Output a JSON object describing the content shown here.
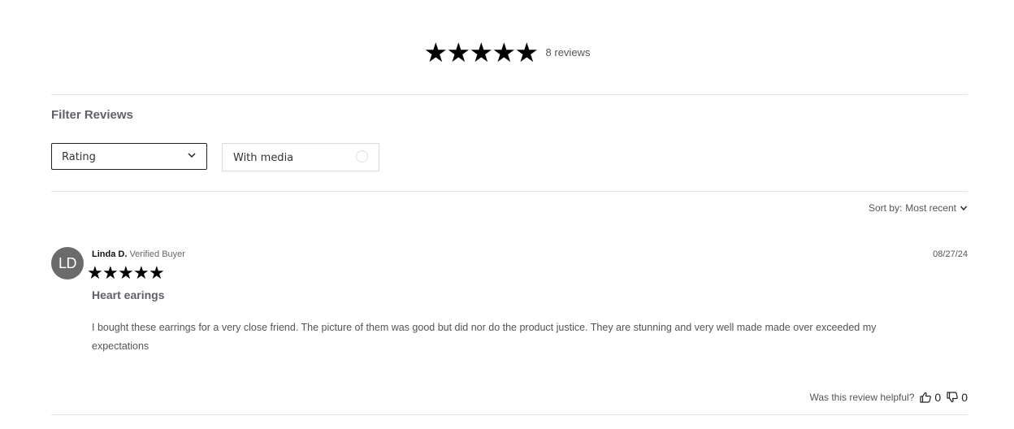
{
  "summary": {
    "rating_stars": 5,
    "review_count_label": "8 reviews"
  },
  "filters": {
    "title": "Filter Reviews",
    "rating_select_label": "Rating",
    "with_media_label": "With media"
  },
  "sort": {
    "label": "Sort by:",
    "value": "Most recent"
  },
  "review": {
    "avatar_initials": "LD",
    "name": "Linda D.",
    "badge": "Verified Buyer",
    "date": "08/27/24",
    "rating_stars": 5,
    "title": "Heart earings",
    "body": "I bought these earrings for a very close friend. The picture of them was good but did nor do the product justice. They are stunning and very well made made over exceeded my expectations",
    "helpful_prompt": "Was this review helpful?",
    "thumbs_up_count": "0",
    "thumbs_down_count": "0"
  }
}
